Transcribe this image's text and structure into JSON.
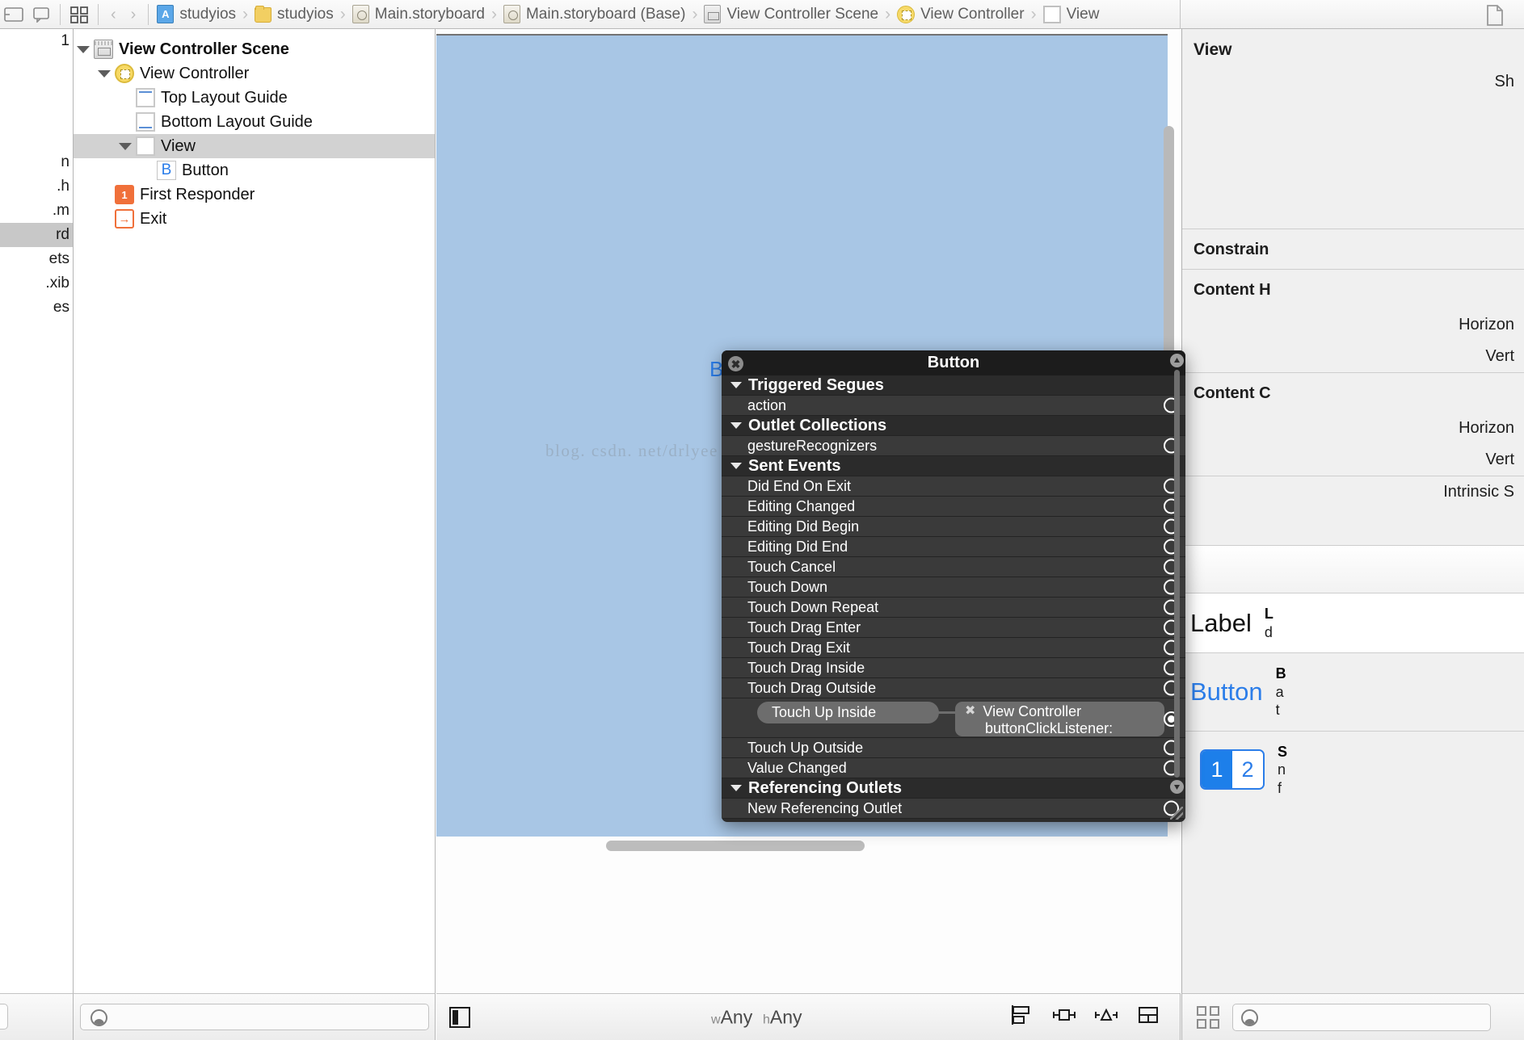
{
  "jumpbar": {
    "breadcrumbs": [
      {
        "label": "studyios",
        "icon": "project-icon"
      },
      {
        "label": "studyios",
        "icon": "folder-icon"
      },
      {
        "label": "Main.storyboard",
        "icon": "storyboard-icon"
      },
      {
        "label": "Main.storyboard (Base)",
        "icon": "storyboard-icon"
      },
      {
        "label": "View Controller Scene",
        "icon": "scene-icon"
      },
      {
        "label": "View Controller",
        "icon": "view-controller-icon"
      },
      {
        "label": "View",
        "icon": "view-icon"
      }
    ],
    "back_label": "‹",
    "forward_label": "›",
    "chevron": "›"
  },
  "navigator_strip": {
    "rows": [
      {
        "label": "1",
        "selected": false
      },
      {
        "label": "",
        "selected": false
      },
      {
        "label": "",
        "selected": false
      },
      {
        "label": "",
        "selected": false
      },
      {
        "label": "",
        "selected": false
      },
      {
        "label": "n",
        "selected": false
      },
      {
        "label": ".h",
        "selected": false
      },
      {
        "label": ".m",
        "selected": false
      },
      {
        "label": "rd",
        "selected": true
      },
      {
        "label": "ets",
        "selected": false
      },
      {
        "label": ".xib",
        "selected": false
      },
      {
        "label": "es",
        "selected": false
      }
    ]
  },
  "outline": {
    "rows": [
      {
        "label": "View Controller Scene",
        "icon": "scene-icon",
        "indent": 0,
        "expanded": true,
        "bold": true,
        "selected": false
      },
      {
        "label": "View Controller",
        "icon": "view-controller-icon",
        "indent": 1,
        "expanded": true,
        "bold": false,
        "selected": false
      },
      {
        "label": "Top Layout Guide",
        "icon": "top-layout-guide-icon",
        "indent": 2,
        "expanded": null,
        "bold": false,
        "selected": false
      },
      {
        "label": "Bottom Layout Guide",
        "icon": "bottom-layout-guide-icon",
        "indent": 2,
        "expanded": null,
        "bold": false,
        "selected": false
      },
      {
        "label": "View",
        "icon": "view-icon",
        "indent": 2,
        "expanded": true,
        "bold": false,
        "selected": true
      },
      {
        "label": "Button",
        "icon": "button-icon",
        "indent": 3,
        "expanded": null,
        "bold": false,
        "selected": false
      },
      {
        "label": "First Responder",
        "icon": "first-responder-icon",
        "indent": 1,
        "expanded": null,
        "bold": false,
        "selected": false
      },
      {
        "label": "Exit",
        "icon": "exit-icon",
        "indent": 1,
        "expanded": null,
        "bold": false,
        "selected": false
      }
    ],
    "filter_placeholder": ""
  },
  "canvas": {
    "button_glyph": "B",
    "watermark": "blog. csdn. net/drlyee",
    "size_class_w": "wAny",
    "size_class_h": "hAny",
    "size_class_w_prefix": "w",
    "size_class_h_prefix": "h"
  },
  "connections_panel": {
    "title": "Button",
    "close_label": "✖",
    "scroll_up": "▲",
    "scroll_down": "▼",
    "sections": [
      {
        "title": "Triggered Segues",
        "expanded": true,
        "items": [
          {
            "label": "action",
            "connected": false
          }
        ]
      },
      {
        "title": "Outlet Collections",
        "expanded": true,
        "items": [
          {
            "label": "gestureRecognizers",
            "connected": false
          }
        ]
      },
      {
        "title": "Sent Events",
        "expanded": true,
        "items": [
          {
            "label": "Did End On Exit",
            "connected": false
          },
          {
            "label": "Editing Changed",
            "connected": false
          },
          {
            "label": "Editing Did Begin",
            "connected": false
          },
          {
            "label": "Editing Did End",
            "connected": false
          },
          {
            "label": "Touch Cancel",
            "connected": false
          },
          {
            "label": "Touch Down",
            "connected": false
          },
          {
            "label": "Touch Down Repeat",
            "connected": false
          },
          {
            "label": "Touch Drag Enter",
            "connected": false
          },
          {
            "label": "Touch Drag Exit",
            "connected": false
          },
          {
            "label": "Touch Drag Inside",
            "connected": false
          },
          {
            "label": "Touch Drag Outside",
            "connected": false
          },
          {
            "label": "Touch Up Inside",
            "connected": true,
            "target_owner": "View Controller",
            "target_action": "buttonClickListener:",
            "target_remove": "✖"
          },
          {
            "label": "Touch Up Outside",
            "connected": false
          },
          {
            "label": "Value Changed",
            "connected": false
          }
        ]
      },
      {
        "title": "Referencing Outlets",
        "expanded": true,
        "items": [
          {
            "label": "New Referencing Outlet",
            "connected": false
          }
        ]
      }
    ]
  },
  "inspector": {
    "title": "View",
    "show_label": "Sh",
    "sections": [
      {
        "title": "Constrain",
        "rows": []
      },
      {
        "title": "Content H",
        "rows": [
          "Horizon",
          "Vert"
        ]
      },
      {
        "title": "Content C",
        "rows": [
          "Horizon",
          "Vert"
        ]
      }
    ],
    "intrinsic_label": "Intrinsic S",
    "library": [
      {
        "preview": "Label",
        "preview_kind": "label",
        "title": "L",
        "desc": "d"
      },
      {
        "preview": "Button",
        "preview_kind": "button",
        "title": "B",
        "desc_line1": "a",
        "desc_line2": "t"
      },
      {
        "preview_kind": "segmented",
        "segments": [
          "1",
          "2"
        ],
        "selected_segment": 0,
        "title": "S",
        "desc_line1": "n",
        "desc_line2": "f"
      }
    ]
  },
  "bottom_bar": {
    "filter_placeholder": ""
  }
}
